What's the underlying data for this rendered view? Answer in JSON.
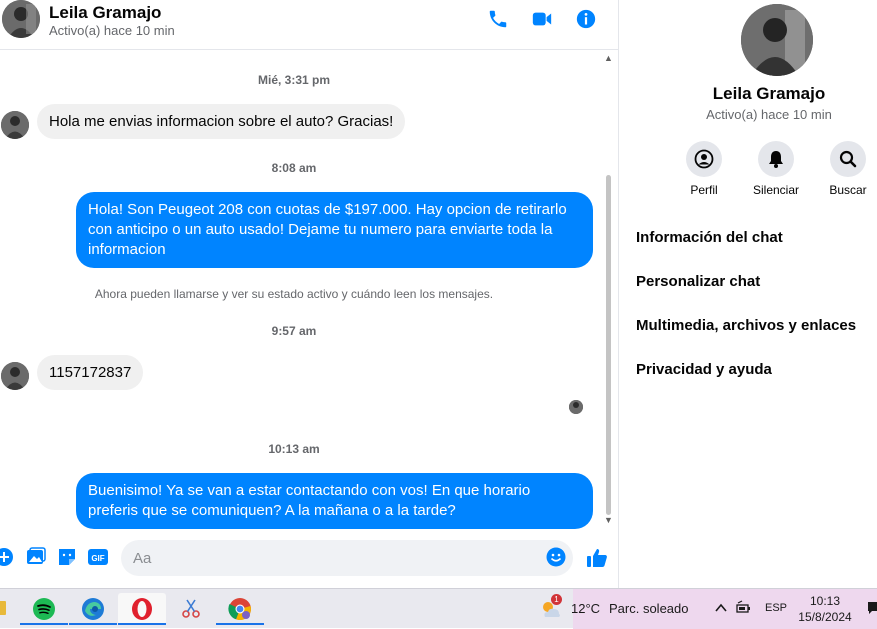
{
  "header": {
    "name": "Leila Gramajo",
    "status": "Activo(a) hace 10 min",
    "icons": [
      "phone-icon",
      "video-camera-icon",
      "info-icon"
    ]
  },
  "messages": {
    "ts1": "Mié, 3:31 pm",
    "msg1": "Hola me envias informacion sobre el auto? Gracias!",
    "ts2": "8:08 am",
    "msg2": "Hola! Son Peugeot 208 con cuotas de $197.000. Hay opcion de retirarlo con anticipo o un auto usado! Dejame tu numero para enviarte toda la informacion",
    "notice": "Ahora pueden llamarse y ver su estado activo y cuándo leen los mensajes.",
    "ts3": "9:57 am",
    "msg3": "1157172837",
    "ts4": "10:13 am",
    "msg4": "Buenisimo! Ya se van a estar contactando con vos! En que horario preferis que se comuniquen? A la mañana o a la tarde?"
  },
  "composer": {
    "placeholder": "Aa",
    "icons": [
      "plus-icon",
      "image-icon",
      "sticker-icon",
      "gif-icon",
      "emoji-icon",
      "thumbs-up-icon"
    ],
    "gif_label": "GIF"
  },
  "panel": {
    "name": "Leila Gramajo",
    "status": "Activo(a) hace 10 min",
    "actions": [
      {
        "label": "Perfil",
        "icon": "profile-icon"
      },
      {
        "label": "Silenciar",
        "icon": "bell-icon"
      },
      {
        "label": "Buscar",
        "icon": "search-icon"
      }
    ],
    "menu": [
      "Información del chat",
      "Personalizar chat",
      "Multimedia, archivos y enlaces",
      "Privacidad y ayuda"
    ]
  },
  "taskbar": {
    "apps": [
      "spotify-icon",
      "edge-icon",
      "opera-icon",
      "snipping-tool-icon",
      "chrome-icon"
    ],
    "weather_badge": "1",
    "temperature": "12°C",
    "weather": "Parc. soleado",
    "language": "ESP",
    "time": "10:13",
    "date": "15/8/2024"
  },
  "colors": {
    "accent": "#0084ff",
    "incoming_bubble": "#f0f0f0",
    "tray_highlight": "#eed8ee"
  }
}
